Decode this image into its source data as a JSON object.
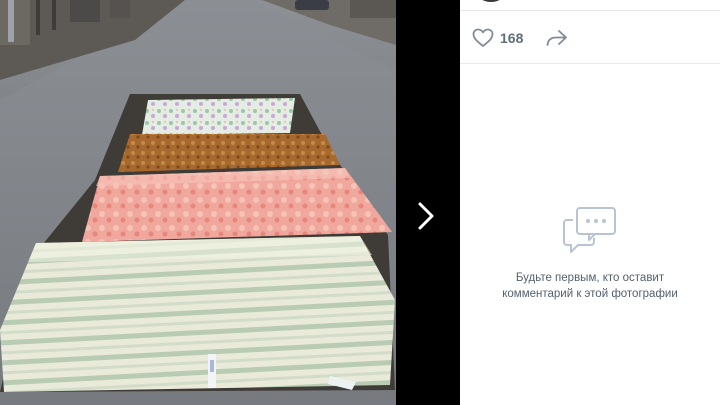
{
  "viewer": {
    "next_icon": "chevron-right-icon"
  },
  "post": {
    "likes": "168",
    "like_icon": "heart-outline-icon",
    "share_icon": "share-arrow-icon"
  },
  "comments": {
    "empty_icon": "comment-bubbles-icon",
    "empty_line1": "Будьте первым, кто оставит",
    "empty_line2": "комментарий к этой фотографии"
  },
  "colors": {
    "panel_bg": "#ffffff",
    "viewer_bg": "#000000",
    "icon_gray": "#828a99",
    "icon_blue_gray": "#b8c4d2",
    "count_color": "#626d7a"
  }
}
